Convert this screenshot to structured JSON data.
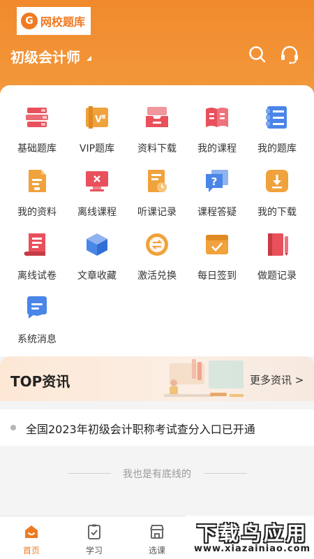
{
  "header": {
    "logo_text": "网校题库",
    "logo_mark": "G",
    "course_title": "初级会计师",
    "icons": [
      "search-icon",
      "headset-icon"
    ]
  },
  "grid_items": [
    {
      "label": "基础题库",
      "icon": "books-icon",
      "color": "#e8505b"
    },
    {
      "label": "VIP题库",
      "icon": "vip-books-icon",
      "color": "#f0a23c"
    },
    {
      "label": "资料下载",
      "icon": "tray-download-icon",
      "color": "#e8505b"
    },
    {
      "label": "我的课程",
      "icon": "open-book-icon",
      "color": "#e8505b"
    },
    {
      "label": "我的题库",
      "icon": "question-list-icon",
      "color": "#4a86e8"
    },
    {
      "label": "我的资料",
      "icon": "document-icon",
      "color": "#f0a23c"
    },
    {
      "label": "离线课程",
      "icon": "monitor-icon",
      "color": "#e8505b"
    },
    {
      "label": "听课记录",
      "icon": "record-clock-icon",
      "color": "#f0a23c"
    },
    {
      "label": "课程答疑",
      "icon": "question-bubble-icon",
      "color": "#4a86e8"
    },
    {
      "label": "我的下载",
      "icon": "download-icon",
      "color": "#f0a23c"
    },
    {
      "label": "离线试卷",
      "icon": "paper-scroll-icon",
      "color": "#e8505b"
    },
    {
      "label": "文章收藏",
      "icon": "cube-icon",
      "color": "#4a86e8"
    },
    {
      "label": "激活兑换",
      "icon": "exchange-coin-icon",
      "color": "#f0a23c"
    },
    {
      "label": "每日签到",
      "icon": "calendar-check-icon",
      "color": "#f0a23c"
    },
    {
      "label": "做题记录",
      "icon": "notebook-pen-icon",
      "color": "#e8505b"
    },
    {
      "label": "系统消息",
      "icon": "chat-bubble-icon",
      "color": "#4a86e8"
    }
  ],
  "top_news": {
    "title": "TOP资讯",
    "more_label": "更多资讯 >",
    "items": [
      "全国2023年初级会计职称考试查分入口已开通"
    ]
  },
  "footer_note": "我也是有底线的",
  "tabbar": {
    "tabs": [
      {
        "label": "首页",
        "icon": "home-icon",
        "active": true
      },
      {
        "label": "学习",
        "icon": "study-clipboard-icon",
        "active": false
      },
      {
        "label": "选课",
        "icon": "store-icon",
        "active": false
      }
    ]
  },
  "watermark": {
    "main": "下载鸟应用",
    "sub": "www.xiazainiao.com"
  },
  "colors": {
    "accent": "#ef7a22",
    "header_gradient_start": "#f08a2c",
    "header_gradient_end": "#f39a3e"
  }
}
